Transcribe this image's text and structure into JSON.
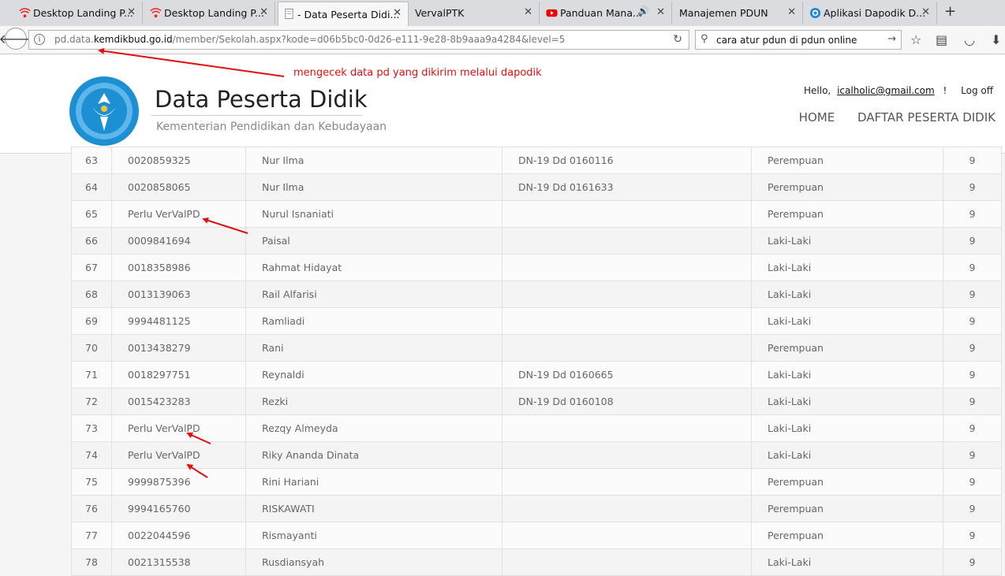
{
  "tabs": [
    {
      "label": "Desktop Landing P...",
      "icon": "signal-icon",
      "active": false
    },
    {
      "label": "Desktop Landing P...",
      "icon": "signal-icon",
      "active": false
    },
    {
      "label": "- Data Peserta Didi...",
      "icon": "page-icon",
      "active": true
    },
    {
      "label": "VervalPTK",
      "icon": "",
      "active": false
    },
    {
      "label": "Panduan Mana...",
      "icon": "youtube-icon",
      "active": false
    },
    {
      "label": "Manajemen PDUN",
      "icon": "",
      "active": false
    },
    {
      "label": "Aplikasi Dapodik D...",
      "icon": "globe-icon",
      "active": false
    }
  ],
  "navbar": {
    "url_prefix": "pd.data.",
    "url_domain": "kemdikbud.go.id",
    "url_path": "/member/Sekolah.aspx?kode=d06b5bc0-0d26-e111-9e28-8b9aaa9a4284&level=5",
    "search_value": "cara atur pdun di pdun online"
  },
  "header": {
    "title": "Data Peserta Didik",
    "subtitle": "Kementerian Pendidikan dan Kebudayaan",
    "hello": "Hello,",
    "user_email": "icalholic@gmail.com",
    "separator": "!",
    "logoff": "Log off",
    "menu": [
      "HOME",
      "DAFTAR PESERTA DIDIK"
    ]
  },
  "annotation": "mengecek data pd yang dikirim melalui dapodik",
  "rows": [
    {
      "no": "63",
      "nisn": "0020859325",
      "nama": "Nur Ilma",
      "ijazah": "DN-19 Dd 0160116",
      "jk": "Perempuan",
      "kelas": "9"
    },
    {
      "no": "64",
      "nisn": "0020858065",
      "nama": "Nur Ilma",
      "ijazah": "DN-19 Dd 0161633",
      "jk": "Perempuan",
      "kelas": "9"
    },
    {
      "no": "65",
      "nisn": "Perlu VerValPD",
      "nama": "Nurul Isnaniati",
      "ijazah": "",
      "jk": "Perempuan",
      "kelas": "9"
    },
    {
      "no": "66",
      "nisn": "0009841694",
      "nama": "Paisal",
      "ijazah": "",
      "jk": "Laki-Laki",
      "kelas": "9"
    },
    {
      "no": "67",
      "nisn": "0018358986",
      "nama": "Rahmat Hidayat",
      "ijazah": "",
      "jk": "Laki-Laki",
      "kelas": "9"
    },
    {
      "no": "68",
      "nisn": "0013139063",
      "nama": "Rail Alfarisi",
      "ijazah": "",
      "jk": "Laki-Laki",
      "kelas": "9"
    },
    {
      "no": "69",
      "nisn": "9994481125",
      "nama": "Ramliadi",
      "ijazah": "",
      "jk": "Laki-Laki",
      "kelas": "9"
    },
    {
      "no": "70",
      "nisn": "0013438279",
      "nama": "Rani",
      "ijazah": "",
      "jk": "Perempuan",
      "kelas": "9"
    },
    {
      "no": "71",
      "nisn": "0018297751",
      "nama": "Reynaldi",
      "ijazah": "DN-19 Dd 0160665",
      "jk": "Laki-Laki",
      "kelas": "9"
    },
    {
      "no": "72",
      "nisn": "0015423283",
      "nama": "Rezki",
      "ijazah": "DN-19 Dd 0160108",
      "jk": "Laki-Laki",
      "kelas": "9"
    },
    {
      "no": "73",
      "nisn": "Perlu VerValPD",
      "nama": "Rezqy Almeyda",
      "ijazah": "",
      "jk": "Laki-Laki",
      "kelas": "9"
    },
    {
      "no": "74",
      "nisn": "Perlu VerValPD",
      "nama": "Riky Ananda Dinata",
      "ijazah": "",
      "jk": "Laki-Laki",
      "kelas": "9"
    },
    {
      "no": "75",
      "nisn": "9999875396",
      "nama": "Rini Hariani",
      "ijazah": "",
      "jk": "Perempuan",
      "kelas": "9"
    },
    {
      "no": "76",
      "nisn": "9994165760",
      "nama": "RISKAWATI",
      "ijazah": "",
      "jk": "Perempuan",
      "kelas": "9"
    },
    {
      "no": "77",
      "nisn": "0022044596",
      "nama": "Rismayanti",
      "ijazah": "",
      "jk": "Perempuan",
      "kelas": "9"
    },
    {
      "no": "78",
      "nisn": "0021315538",
      "nama": "Rusdiansyah",
      "ijazah": "",
      "jk": "Laki-Laki",
      "kelas": "9"
    }
  ]
}
